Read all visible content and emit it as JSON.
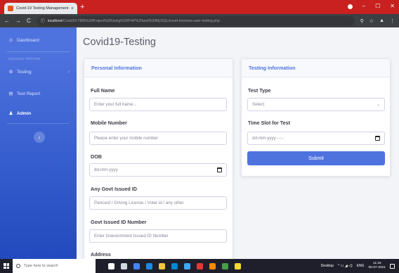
{
  "browser": {
    "tab_title": "Covid-19 Testing Management S",
    "tab_close": "×",
    "new_tab": "+",
    "url_host": "localhost",
    "url_path": "/Covid19-TMS%20Project%20Using%20PHP%20and%20MySQL/covid-tms/new-user-testing.php",
    "nav": {
      "back": "←",
      "forward": "→",
      "reload": "C"
    },
    "info_icon": "ⓘ",
    "right_icons": [
      "⚲",
      "☆",
      "▲",
      "⋮"
    ],
    "window_controls": [
      "–",
      "☐",
      "✕"
    ],
    "icons": [
      "favicon",
      "close-icon",
      "plus-icon",
      "back-arrow-icon",
      "forward-arrow-icon",
      "reload-icon",
      "info-icon",
      "zoom-icon",
      "star-icon",
      "extension-icon",
      "menu-icon"
    ]
  },
  "sidebar": {
    "dashboard": {
      "icon": "dashboard-icon",
      "glyph": "⊙",
      "label": "Dashboard"
    },
    "section_heading": "COVID19 TESTING",
    "testing": {
      "icon": "gear-icon",
      "glyph": "⚙",
      "label": "Testing",
      "chevron": "›"
    },
    "test_report": {
      "icon": "file-icon",
      "glyph": "▤",
      "label": "Test Report"
    },
    "admin": {
      "icon": "user-icon",
      "glyph": "♟",
      "label": "Admin"
    },
    "toggle_glyph": "‹",
    "colors": {
      "top": "#4e73df",
      "bottom": "#224abe"
    }
  },
  "main": {
    "page_title": "Covid19-Testing",
    "personal_card": {
      "header": "Personal Information",
      "full_name": {
        "label": "Full Name",
        "placeholder": "Enter your full name..."
      },
      "mobile": {
        "label": "Mobile Number",
        "placeholder": "Please enter your mobile number"
      },
      "dob": {
        "label": "DOB",
        "placeholder": "dd-mm-yyyy"
      },
      "govt_id": {
        "label": "Any Govt Issued ID",
        "placeholder": "Pancard / Driving License / Voter id / any other"
      },
      "govt_id_number": {
        "label": "Govt Issued ID Number",
        "placeholder": "Enter Goevernment Issued ID Number"
      },
      "address": {
        "label": "Address"
      }
    },
    "testing_card": {
      "header": "Testing Information",
      "test_type": {
        "label": "Test Type",
        "selected": "Select",
        "caret": "⌄"
      },
      "time_slot": {
        "label": "Time Slot for Test",
        "placeholder": "dd-mm-yyyy --:--"
      },
      "submit": "Submit"
    },
    "accent_color": "#4e73df"
  },
  "taskbar": {
    "search_placeholder": "Type here to search",
    "apps": [
      {
        "name": "cortana-icon",
        "color": "#ffffff"
      },
      {
        "name": "task-view-icon",
        "color": "#cfd8dc"
      },
      {
        "name": "chrome-icon",
        "color": "#4285f4"
      },
      {
        "name": "edge-icon",
        "color": "#1e88e5"
      },
      {
        "name": "folder-icon",
        "color": "#f4c542"
      },
      {
        "name": "store-icon",
        "color": "#0288d1"
      },
      {
        "name": "mail-icon",
        "color": "#42a5f5"
      },
      {
        "name": "terminal-icon",
        "color": "#e53935"
      },
      {
        "name": "app-icon",
        "color": "#fb8c00"
      },
      {
        "name": "app-icon-2",
        "color": "#43a047"
      },
      {
        "name": "app-icon-3",
        "color": "#fdd835"
      }
    ],
    "desktop_label": "Desktop",
    "tray_icons": "^ ▭ ◢ ◁)",
    "lang": "ENG",
    "time": "11:16",
    "date": "05-07-2021"
  }
}
